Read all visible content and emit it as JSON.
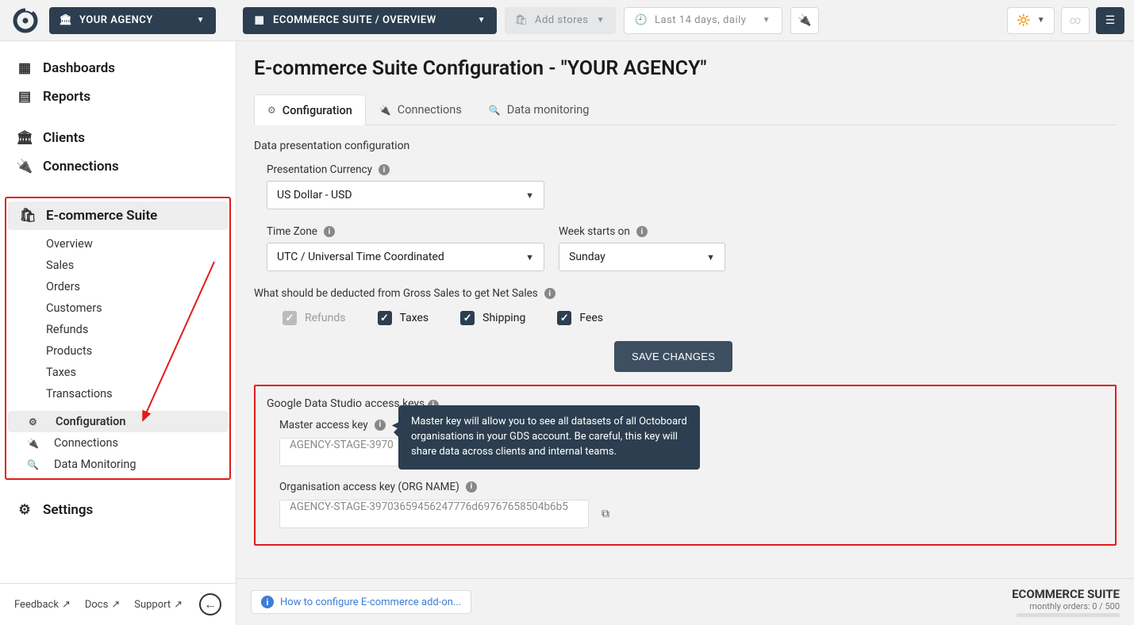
{
  "topbar": {
    "agency_label": "YOUR AGENCY",
    "suite_label": "ECOMMERCE SUITE / OVERVIEW",
    "add_stores": "Add stores",
    "date_range": "Last 14 days, daily"
  },
  "sidebar": {
    "dashboards": "Dashboards",
    "reports": "Reports",
    "clients": "Clients",
    "connections": "Connections",
    "ecommerce": "E-commerce Suite",
    "sub": {
      "overview": "Overview",
      "sales": "Sales",
      "orders": "Orders",
      "customers": "Customers",
      "refunds": "Refunds",
      "products": "Products",
      "taxes": "Taxes",
      "transactions": "Transactions",
      "configuration": "Configuration",
      "connections": "Connections",
      "monitoring": "Data Monitoring"
    },
    "settings": "Settings",
    "footer": {
      "feedback": "Feedback",
      "docs": "Docs",
      "support": "Support"
    }
  },
  "main": {
    "title": "E-commerce Suite Configuration - \"YOUR AGENCY\"",
    "tabs": {
      "configuration": "Configuration",
      "connections": "Connections",
      "monitoring": "Data monitoring"
    },
    "section1_title": "Data presentation configuration",
    "currency_label": "Presentation Currency",
    "currency_value": "US Dollar - USD",
    "tz_label": "Time Zone",
    "tz_value": "UTC / Universal Time Coordinated",
    "week_label": "Week starts on",
    "week_value": "Sunday",
    "deduct_label": "What should be deducted from Gross Sales to get Net Sales",
    "cb_refunds": "Refunds",
    "cb_taxes": "Taxes",
    "cb_shipping": "Shipping",
    "cb_fees": "Fees",
    "save_btn": "SAVE CHANGES",
    "section2_title": "Google Data Studio access keys",
    "master_label": "Master access key",
    "master_value": "AGENCY-STAGE-3970",
    "org_label": "Organisation access key (ORG NAME)",
    "org_value": "AGENCY-STAGE-39703659456247776d69767658504b6b5",
    "tooltip_text": "Master key will allow you to see all datasets of all Octoboard organisations in your GDS account. Be careful, this key will share data across clients and internal teams."
  },
  "footer": {
    "help_text": "How to configure E-commerce add-on...",
    "suite_name": "ECOMMERCE SUITE",
    "orders_meta": "monthly orders: 0 / 500"
  }
}
